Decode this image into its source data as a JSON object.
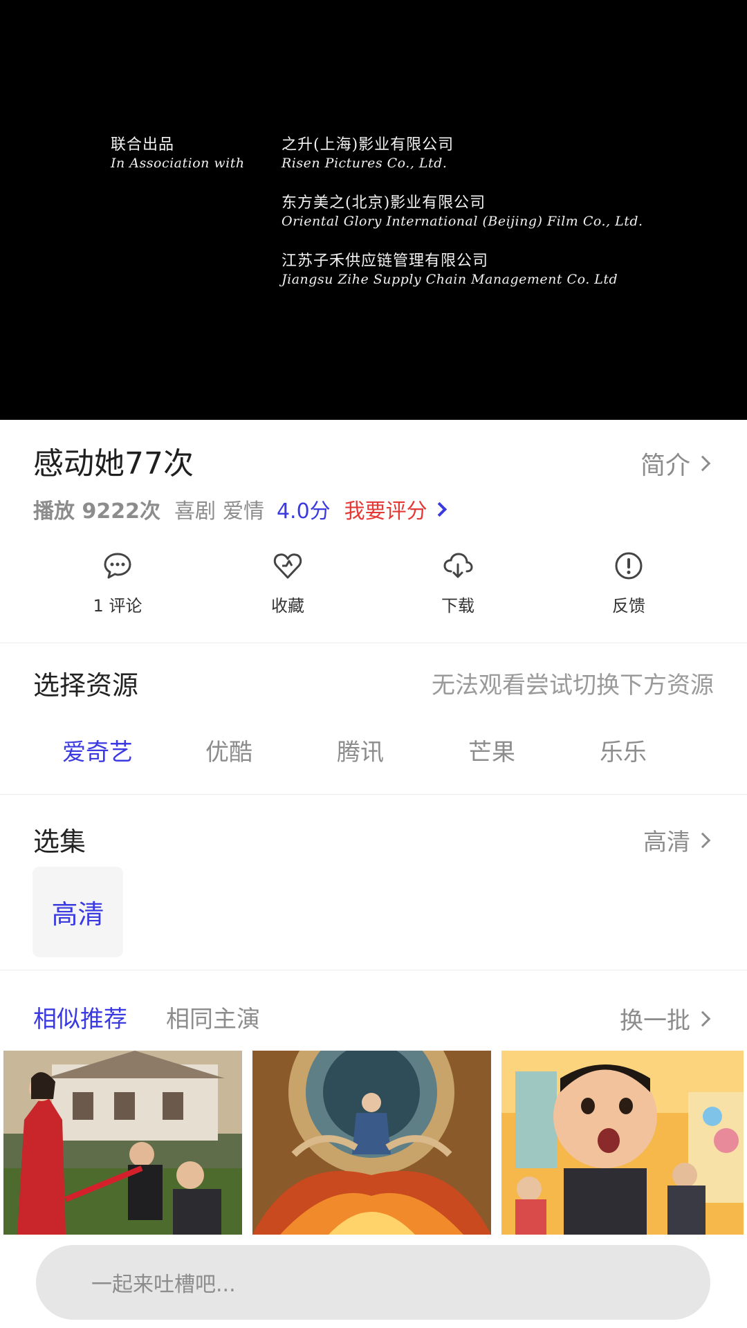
{
  "player": {
    "credit_role_zh": "联合出品",
    "credit_role_en": "In Association with",
    "companies": [
      {
        "zh": "之升(上海)影业有限公司",
        "en": "Risen Pictures Co., Ltd."
      },
      {
        "zh": "东方美之(北京)影业有限公司",
        "en": "Oriental Glory International (Beijing) Film Co., Ltd."
      },
      {
        "zh": "江苏子禾供应链管理有限公司",
        "en": "Jiangsu Zihe Supply Chain Management Co. Ltd"
      }
    ]
  },
  "movie": {
    "title": "感动她77次",
    "intro_label": "简介",
    "plays": "播放 9222次",
    "genres": [
      "喜剧",
      "爱情"
    ],
    "score": "4.0分",
    "rate_label": "我要评分"
  },
  "actions": [
    {
      "label": "1 评论",
      "icon": "comment-icon"
    },
    {
      "label": "收藏",
      "icon": "heart-icon"
    },
    {
      "label": "下载",
      "icon": "cloud-download-icon"
    },
    {
      "label": "反馈",
      "icon": "alert-icon"
    }
  ],
  "source": {
    "title": "选择资源",
    "hint": "无法观看尝试切换下方资源",
    "options": [
      "爱奇艺",
      "优酷",
      "腾讯",
      "芒果",
      "乐乐"
    ],
    "selected": "爱奇艺"
  },
  "episodes": {
    "title": "选集",
    "quality": "高清",
    "items": [
      "高清"
    ]
  },
  "recommend": {
    "tabs": [
      "相似推荐",
      "相同主演"
    ],
    "active_tab": "相似推荐",
    "swap_label": "换一批"
  },
  "comment": {
    "placeholder": "一起来吐槽吧..."
  },
  "colors": {
    "accent": "#3a3ae0",
    "rate": "#e53935",
    "muted": "#8c8c8c"
  }
}
